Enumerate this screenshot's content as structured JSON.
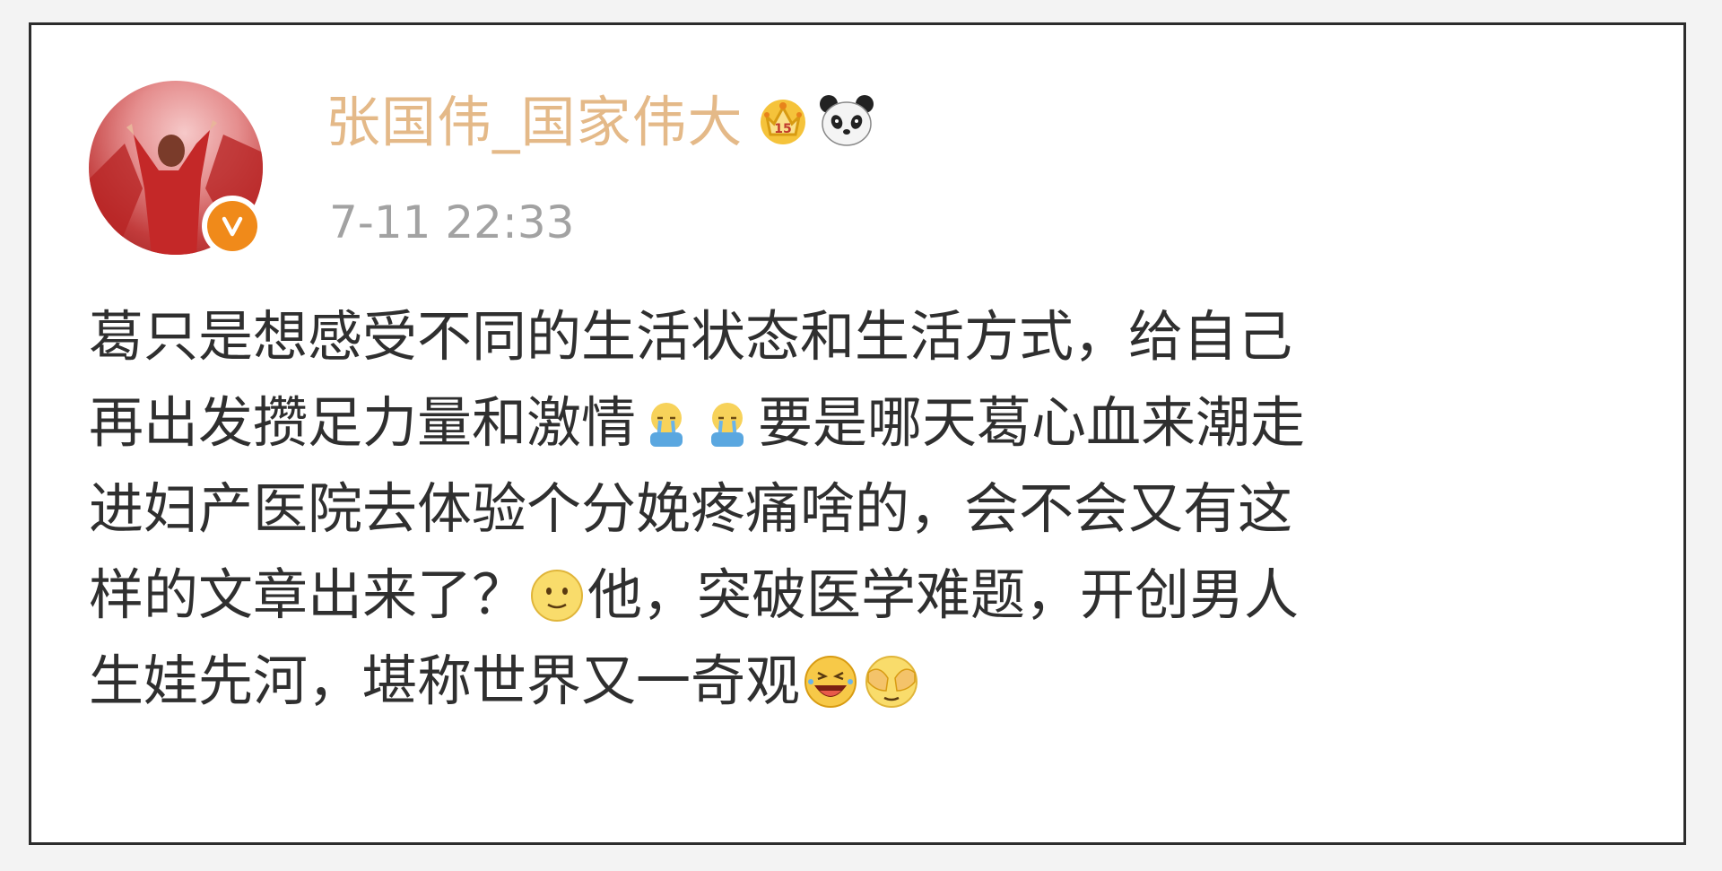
{
  "post": {
    "username": "张国伟_国家伟大",
    "timestamp": "7-11 22:33",
    "badges": [
      "crown-icon",
      "panda-icon"
    ],
    "verified_badge": "v",
    "lines": [
      {
        "a": "葛只是想感受不同的生活状态和生活方式，给自己"
      },
      {
        "a": "再出发攒足力量和激情",
        "emojis": [
          "cry-emoji",
          "cry-emoji"
        ],
        "b": "要是哪天葛心血来潮走"
      },
      {
        "a": "进妇产医院去体验个分娩疼痛啥的，会不会又有这"
      },
      {
        "a": "样的文章出来了？",
        "emoji": "smile-emoji",
        "b": "他，突破医学难题，开创男人"
      },
      {
        "a": "生娃先河，堪称世界又一奇观",
        "emojis": [
          "laugh-emoji",
          "cover-face-emoji"
        ]
      }
    ]
  },
  "colors": {
    "username": "#e4b988",
    "timestamp": "#a2a2a2",
    "body_text": "#2f2f2f",
    "verified": "#f08a1a",
    "border": "#2c2c2c"
  }
}
